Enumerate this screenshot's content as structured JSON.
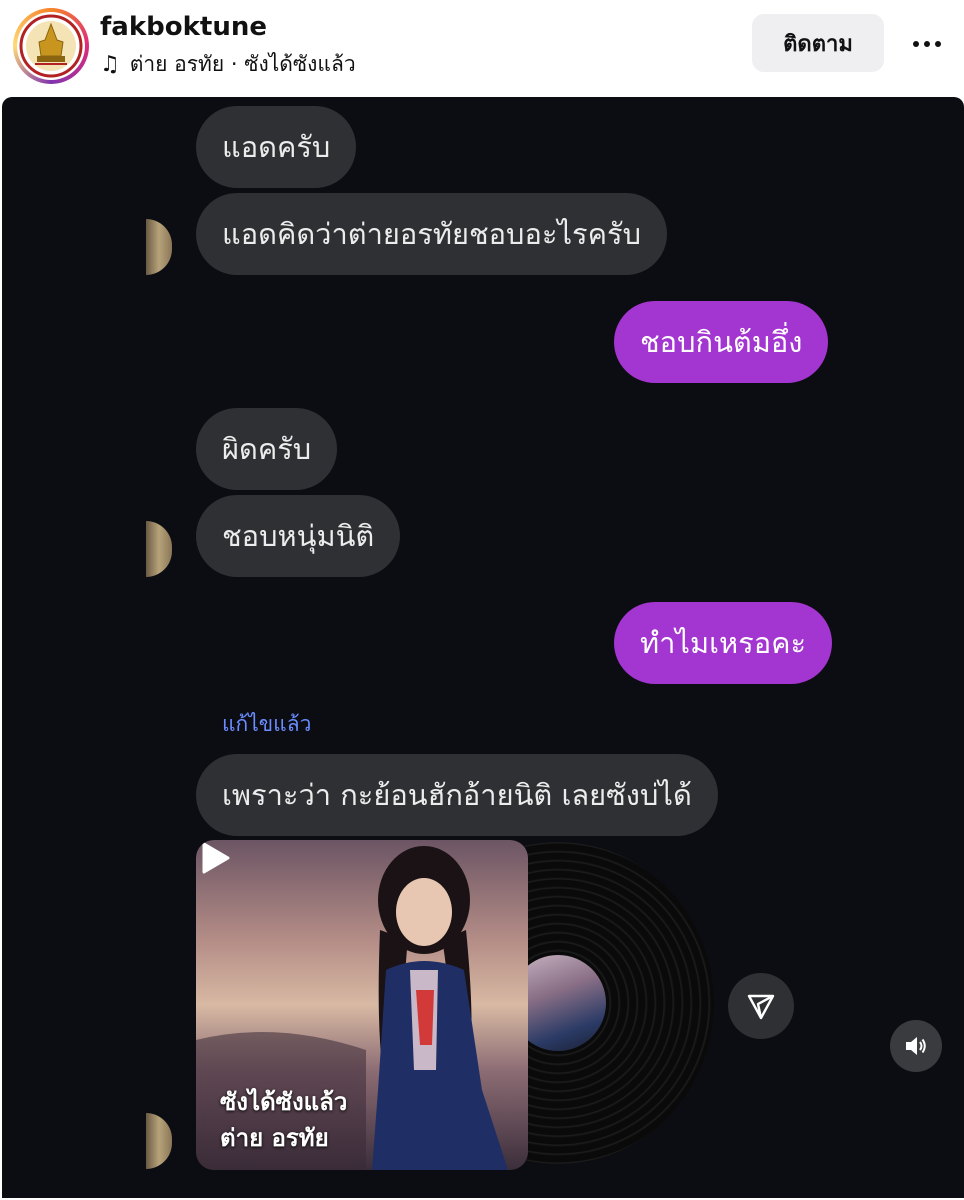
{
  "header": {
    "username": "fakboktune",
    "song_line": "ต่าย อรทัย · ซังได้ซังแล้ว",
    "follow_label": "ติดตาม",
    "icons": {
      "music": "music-note-icon",
      "more": "more-options-icon"
    }
  },
  "chat": {
    "messages": [
      {
        "side": "in",
        "text": "แอดครับ"
      },
      {
        "side": "in",
        "text": "แอดคิดว่าต่ายอรทัยชอบอะไรครับ"
      },
      {
        "side": "out",
        "text": "ชอบกินต้มอึ่ง"
      },
      {
        "side": "in",
        "text": "ผิดครับ"
      },
      {
        "side": "in",
        "text": "ชอบหนุ่มนิติ"
      },
      {
        "side": "out",
        "text": "ทำไมเหรอคะ"
      },
      {
        "side": "in",
        "text": "เพราะว่า กะย้อนฮักอ้ายนิติ เลยซังบ่ได้"
      }
    ],
    "edited_label": "แก้ไขแล้ว",
    "music_card": {
      "song_title": "ซังได้ซังแล้ว",
      "artist": "ต่าย อรทัย"
    },
    "colors": {
      "incoming": "#2f3033",
      "outgoing": "#a335d0",
      "background": "#0c0d12",
      "edited": "#6a8cff"
    }
  }
}
